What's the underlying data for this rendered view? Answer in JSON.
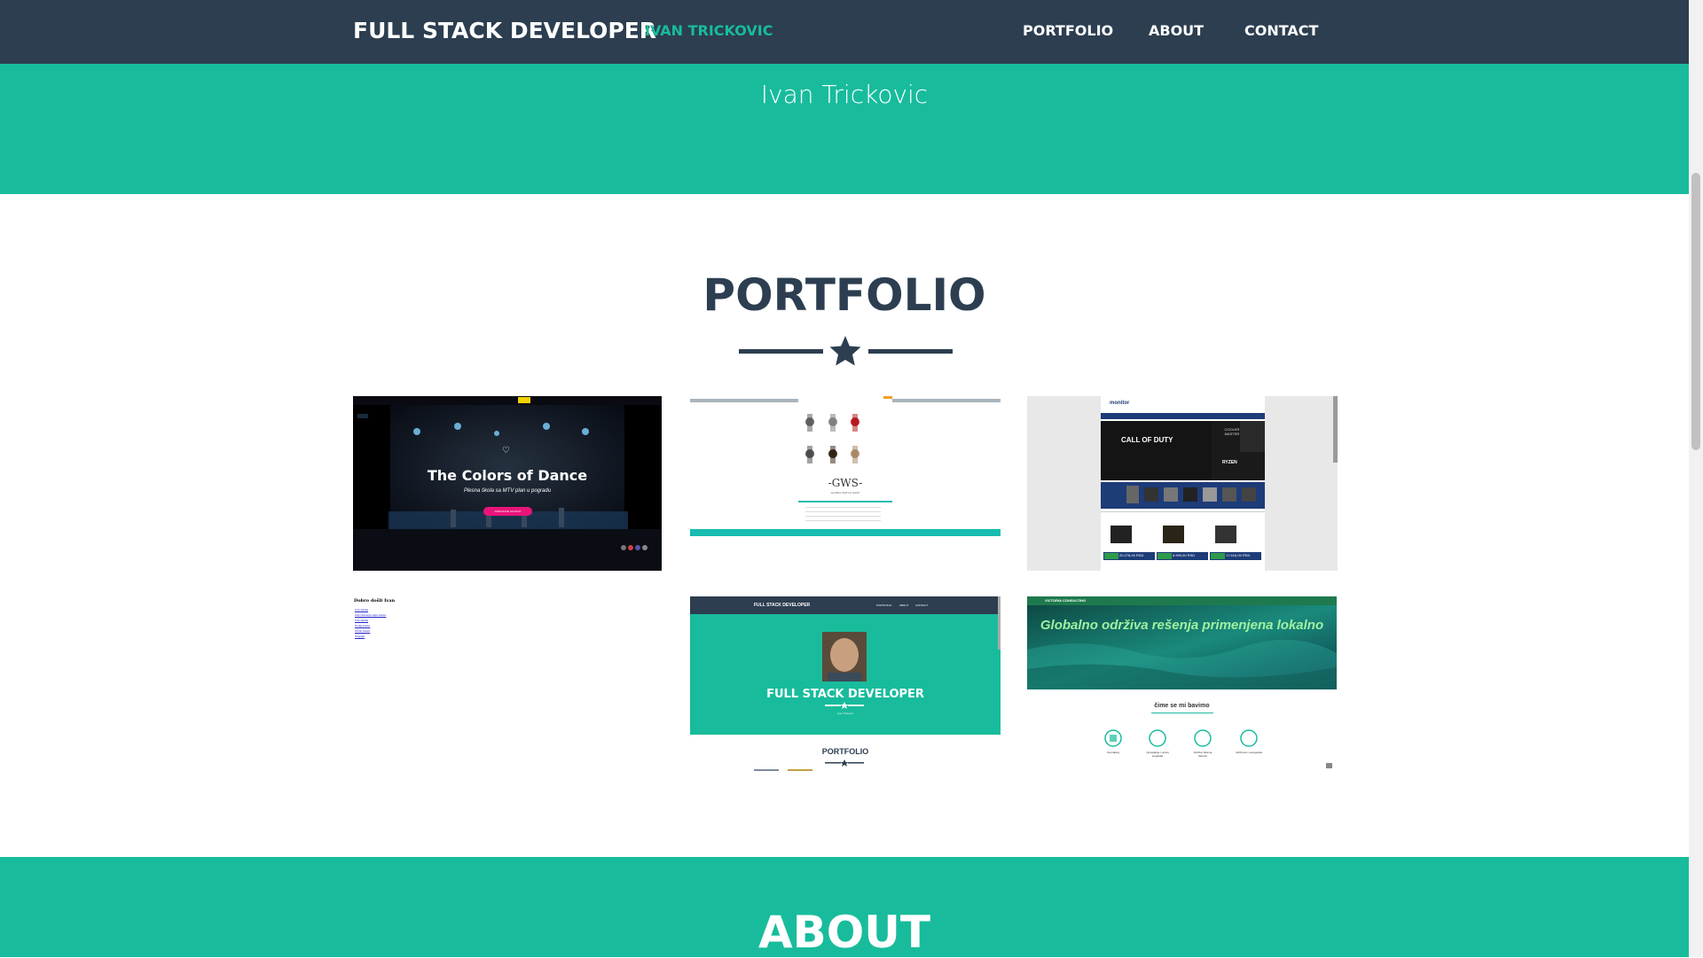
{
  "navbar": {
    "brand": "FULL STACK DEVELOPER",
    "brand_sub": "IVAN TRICKOVIC",
    "links": [
      "PORTFOLIO",
      "ABOUT",
      "CONTACT"
    ]
  },
  "hero": {
    "name": "Ivan Trickovic"
  },
  "portfolio": {
    "title": "PORTFOLIO",
    "items": [
      {
        "heading": "The Colors of Dance",
        "subtitle": "Plesna škola sa MTV plan u pogradu",
        "button": "PRIKAZATE SAJTOVI"
      },
      {
        "logo": "-GWS-",
        "tagline": "GLOBAL WATCH SHOP"
      },
      {
        "logo": "monitor",
        "banner": "CALL OF DUTY",
        "tag1": "RYZEN",
        "tag2": "COOLER MASTER",
        "prices": [
          "20.278,00 RSD",
          "8.990,00 RSD",
          "17.616,00 RSD"
        ]
      },
      {
        "heading": "Dobro došli Ivan",
        "links": [
          "Link stavka",
          "Administracija sajta stavke",
          "Link stavka",
          "Dodaj stavku",
          "Obriši stavku",
          "Izlogujte"
        ]
      },
      {
        "brand": "FULL STACK DEVELOPER",
        "links": [
          "PORTFOLIO",
          "ABOUT",
          "CONTACT"
        ],
        "hero_title": "FULL STACK DEVELOPER",
        "hero_name": "Ivan Trickovic",
        "section": "PORTFOLIO"
      },
      {
        "brand": "VICTORIA CONSULTING",
        "banner": "Globalno održiva rešenja primenjena lokalno",
        "section": "čime se mi bavimo",
        "services": [
          "Konzalting",
          "Upravljanje i razvoj projekata",
          "Održivo Razvoj Zelenih",
          "Održivost i energetska"
        ]
      }
    ]
  },
  "about": {
    "title": "ABOUT"
  },
  "colors": {
    "navy": "#2c3e50",
    "teal": "#18bc9c",
    "white": "#ffffff"
  }
}
